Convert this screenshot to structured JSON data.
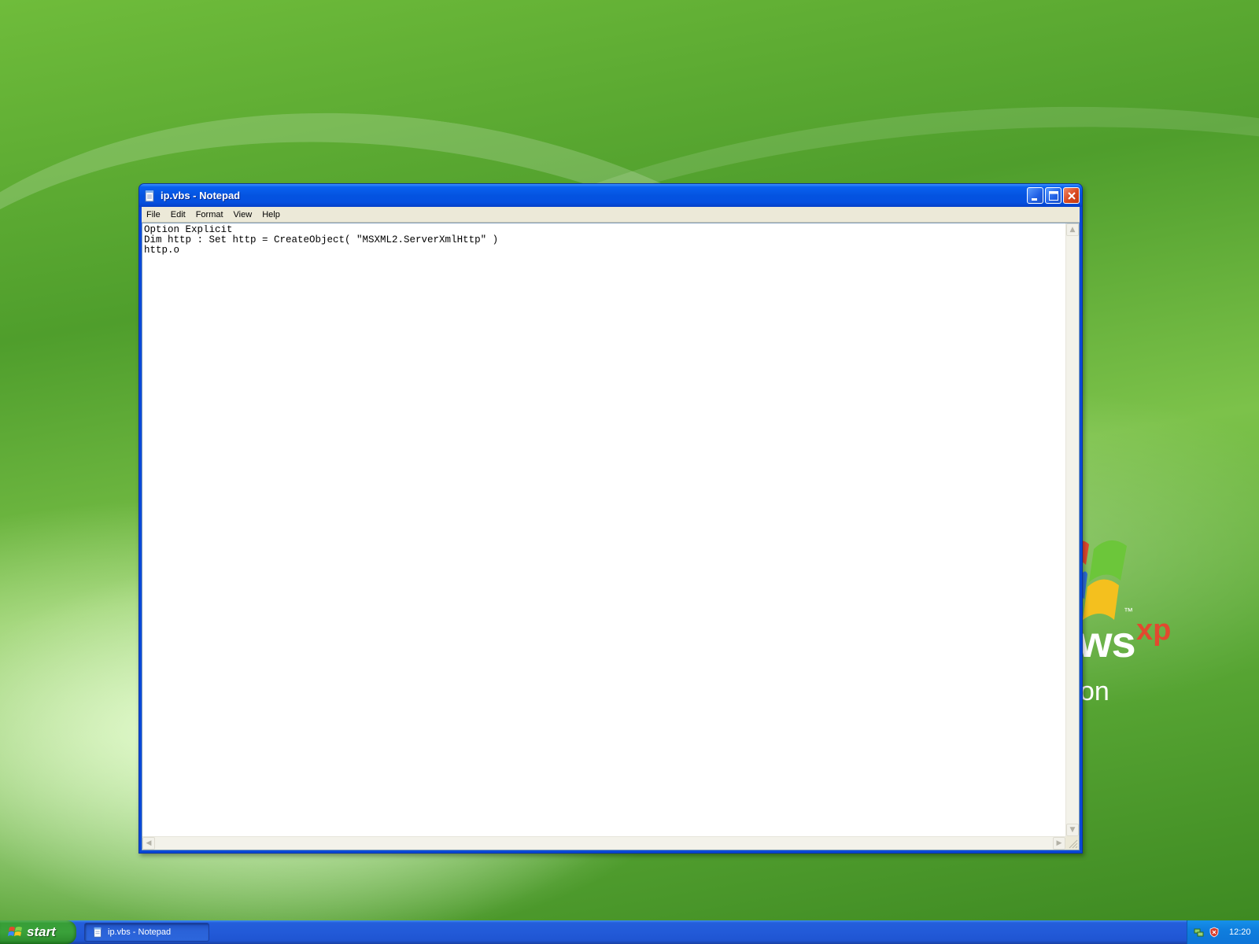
{
  "window": {
    "title": "ip.vbs - Notepad",
    "icon": "notepad-icon",
    "controls": [
      "minimize-icon",
      "maximize-icon",
      "close-icon"
    ]
  },
  "menu": {
    "items": [
      {
        "label": "File"
      },
      {
        "label": "Edit"
      },
      {
        "label": "Format"
      },
      {
        "label": "View"
      },
      {
        "label": "Help"
      }
    ]
  },
  "editor": {
    "content": "Option Explicit\nDim http : Set http = CreateObject( \"MSXML2.ServerXmlHttp\" )\nhttp.o"
  },
  "desktop": {
    "logo_brand": "ws",
    "logo_xp": "xp",
    "logo_tm": "™",
    "logo_edition": "on"
  },
  "taskbar": {
    "start_label": "start",
    "tasks": [
      {
        "label": "ip.vbs - Notepad",
        "icon": "notepad-icon"
      }
    ],
    "tray": {
      "icons": [
        "network-icon",
        "security-shield-icon"
      ],
      "clock": "12:20"
    }
  },
  "colors": {
    "titlebar": "#0453e0",
    "taskbar": "#225ad8",
    "start_button": "#3aa13a",
    "close_button": "#d8471e"
  }
}
